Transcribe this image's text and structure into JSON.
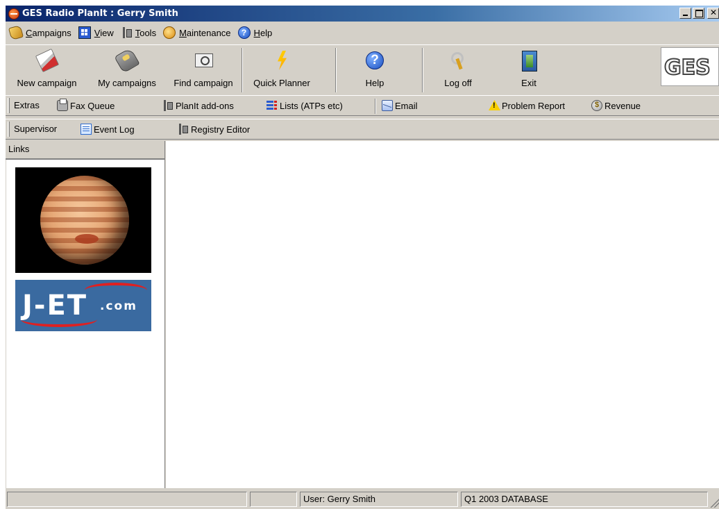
{
  "window": {
    "title": "GES Radio PlanIt :  Gerry Smith"
  },
  "menubar": {
    "items": [
      {
        "label": "Campaigns",
        "icon": "campaigns-icon"
      },
      {
        "label": "View",
        "icon": "view-icon"
      },
      {
        "label": "Tools",
        "icon": "tools-icon"
      },
      {
        "label": "Maintenance",
        "icon": "maintenance-icon"
      },
      {
        "label": "Help",
        "icon": "help-icon"
      }
    ]
  },
  "toolbar": {
    "buttons": [
      {
        "label": "New campaign",
        "icon": "new-campaign-icon"
      },
      {
        "label": "My campaigns",
        "icon": "my-campaigns-icon"
      },
      {
        "label": "Find campaign",
        "icon": "find-campaign-icon"
      },
      {
        "label": "Quick Planner",
        "icon": "lightning-icon"
      },
      {
        "label": "Help",
        "icon": "help-icon"
      },
      {
        "label": "Log off",
        "icon": "key-icon"
      },
      {
        "label": "Exit",
        "icon": "door-icon"
      }
    ],
    "logo_text": "GES"
  },
  "extras_bar": {
    "title": "Extras",
    "items": [
      {
        "label": "Fax Queue",
        "icon": "fax-icon"
      },
      {
        "label": "PlanIt add-ons",
        "icon": "tools-icon"
      },
      {
        "label": "Lists (ATPs etc)",
        "icon": "list-icon"
      },
      {
        "label": "Email",
        "icon": "email-icon"
      },
      {
        "label": "Problem Report",
        "icon": "warning-icon"
      },
      {
        "label": "Revenue",
        "icon": "money-bag-icon"
      }
    ]
  },
  "supervisor_bar": {
    "title": "Supervisor",
    "items": [
      {
        "label": "Event Log",
        "icon": "event-log-icon"
      },
      {
        "label": "Registry Editor",
        "icon": "tools-icon"
      }
    ]
  },
  "links_panel": {
    "title": "Links",
    "jet_logo": {
      "main": "J-ET",
      "suffix": ".com"
    }
  },
  "statusbar": {
    "panes": [
      "",
      "",
      "User: Gerry Smith",
      "Q1 2003 DATABASE"
    ]
  },
  "colors": {
    "title_bar_start": "#0a246a",
    "title_bar_end": "#a6caf0",
    "chrome": "#d4d0c8"
  }
}
